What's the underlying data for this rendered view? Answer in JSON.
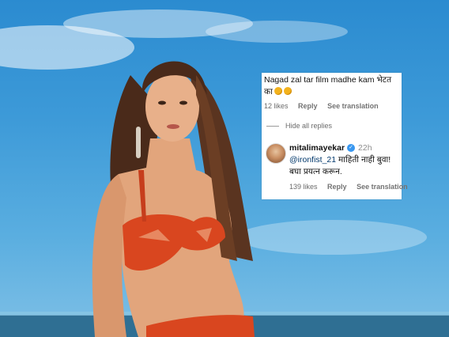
{
  "comment": {
    "text": "Nagad zal tar film madhe kam भेटत का",
    "likes": "12 likes",
    "reply_label": "Reply",
    "translation_label": "See translation"
  },
  "hide_replies_label": "Hide all replies",
  "reply": {
    "username": "mitalimayekar",
    "time": "22h",
    "mention": "@ironfist_21",
    "text": "माहिती नाही बुवा! बघा प्रयत्न करून.",
    "likes": "139 likes",
    "reply_label": "Reply",
    "translation_label": "See translation"
  },
  "colors": {
    "sky": "#3d9ad8",
    "verified": "#3897f0",
    "mention": "#00376b"
  }
}
